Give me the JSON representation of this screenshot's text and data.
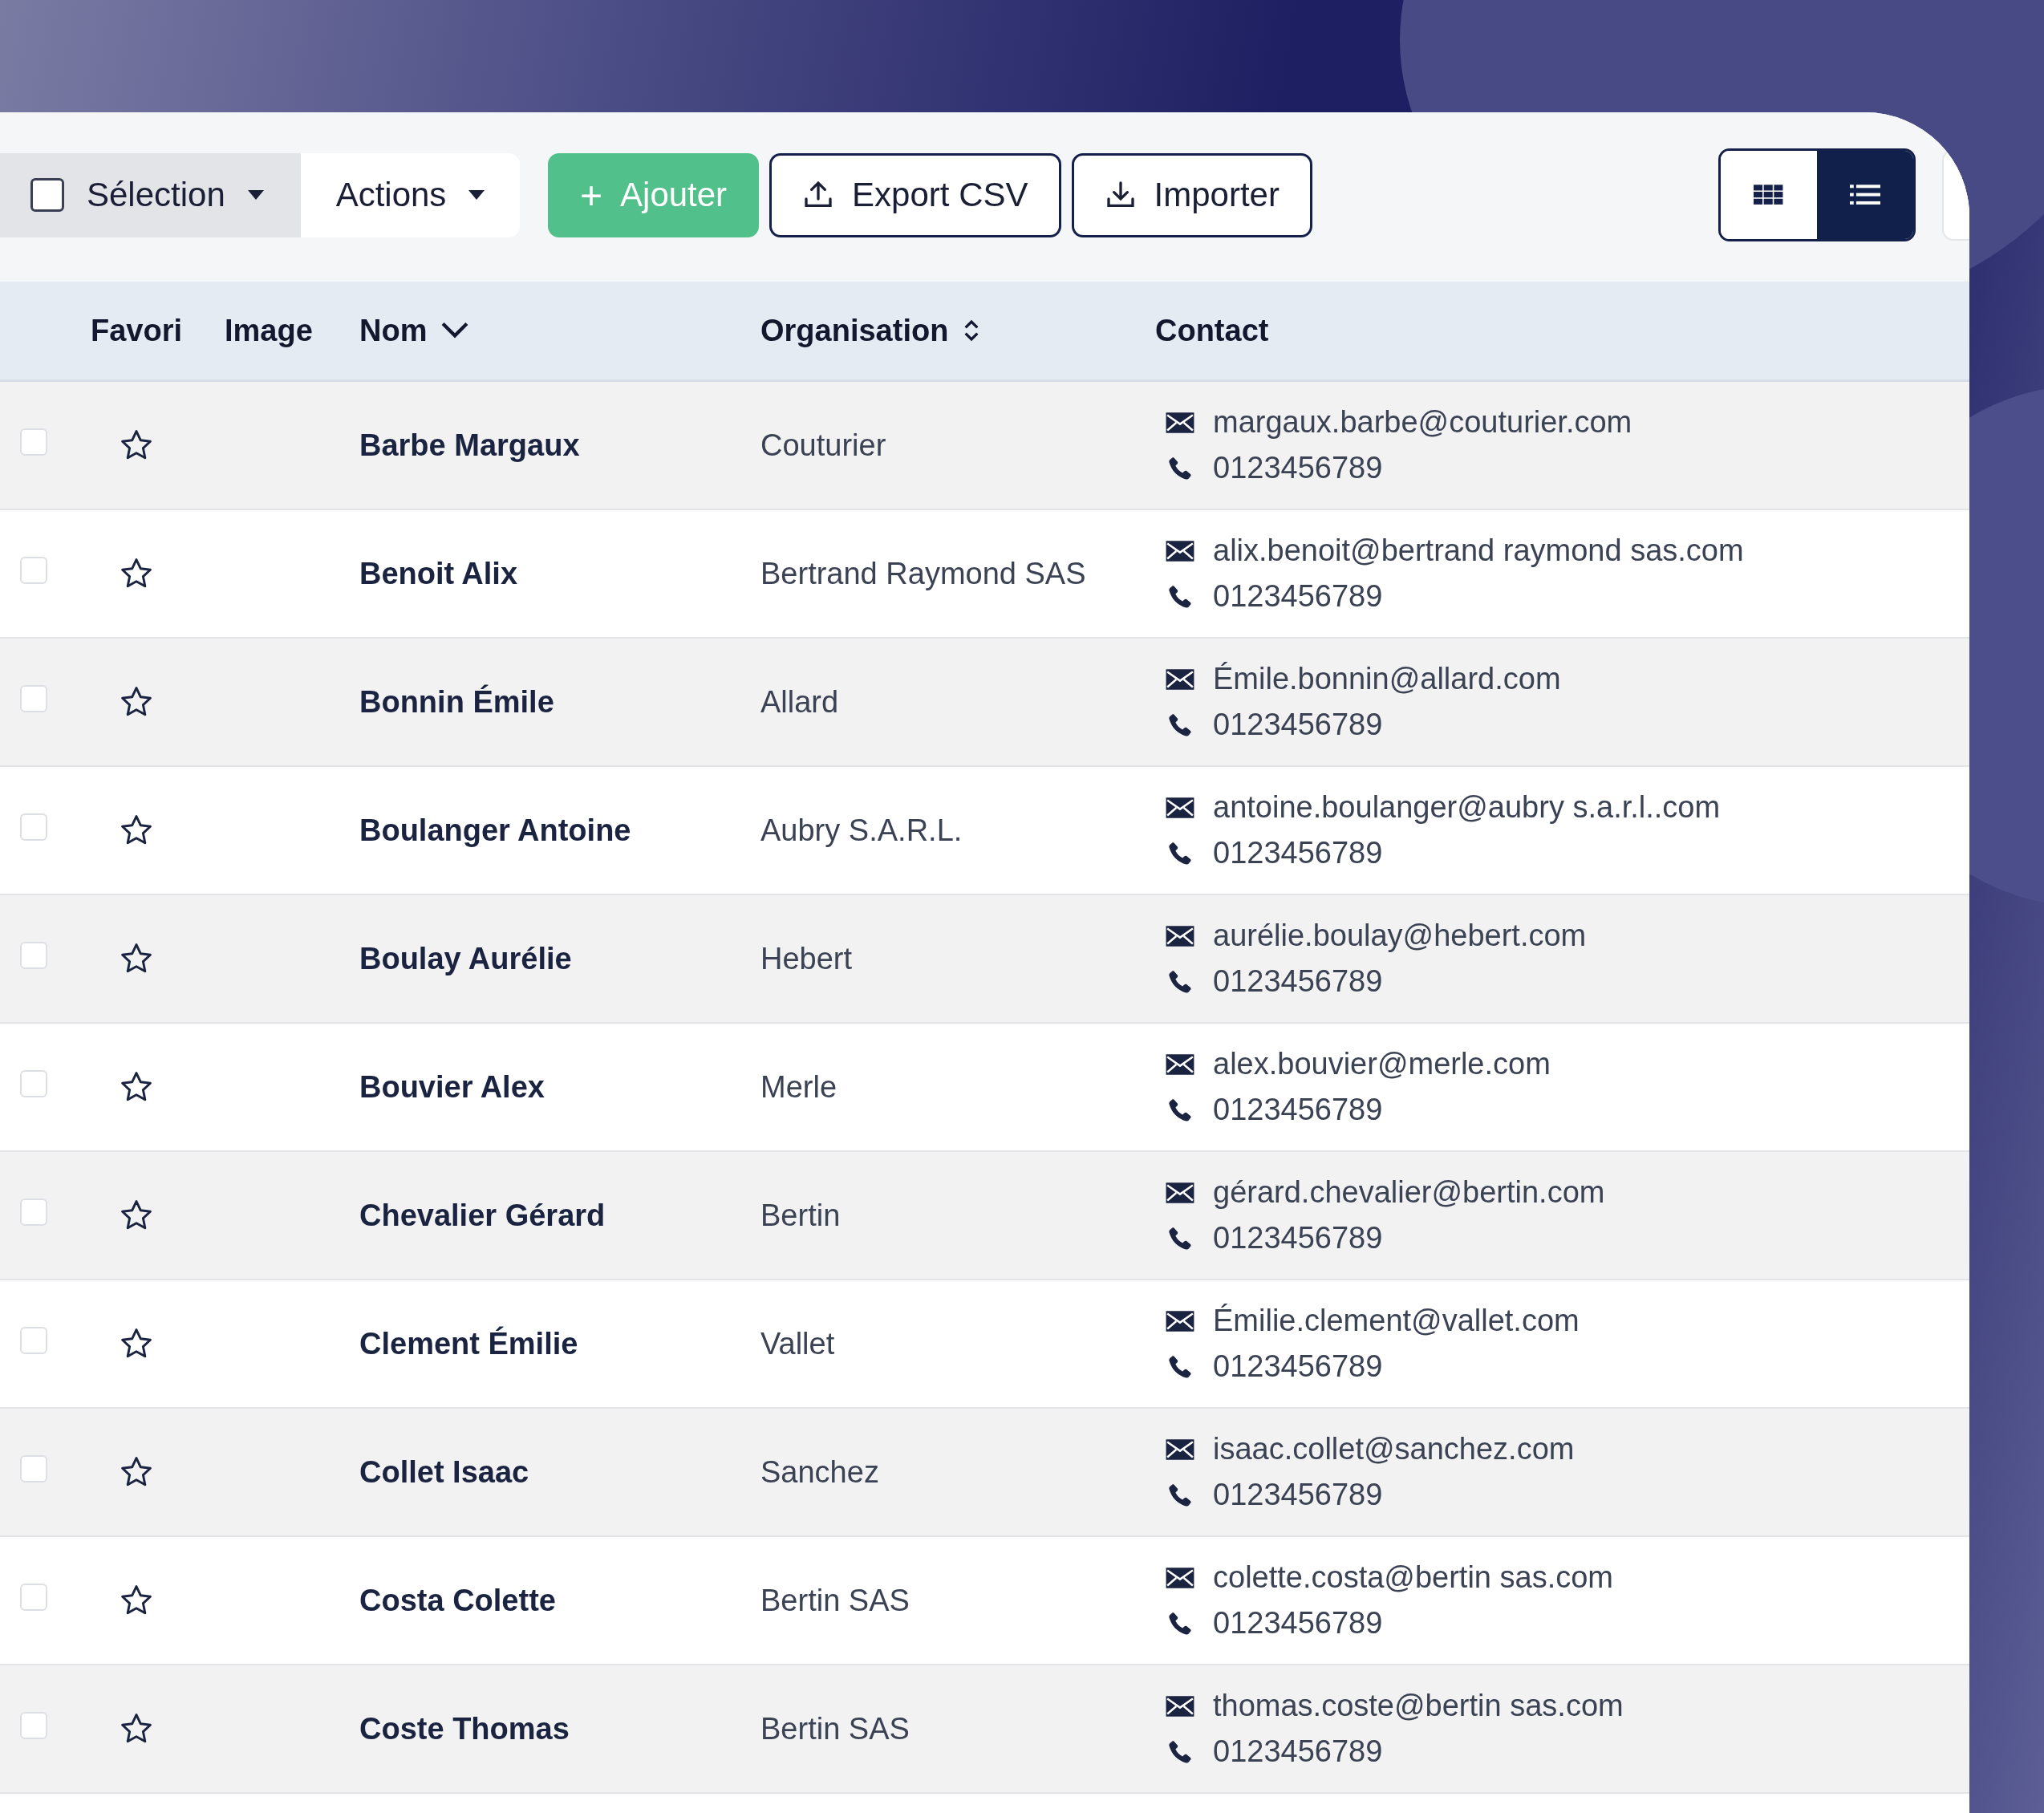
{
  "toolbar": {
    "selection": {
      "label": "Sélection",
      "checked": false
    },
    "actions": {
      "label": "Actions"
    },
    "buttons": [
      {
        "kind": "add",
        "label": "Ajouter",
        "icon": "+"
      },
      {
        "kind": "export",
        "label": "Export CSV"
      },
      {
        "kind": "import",
        "label": "Importer"
      }
    ],
    "view_toggle": [
      {
        "kind": "grid",
        "selected": false
      },
      {
        "kind": "list",
        "selected": true
      }
    ]
  },
  "table": {
    "columns": [
      {
        "label": "Favori"
      },
      {
        "label": "Image"
      },
      {
        "label": "Nom",
        "sorted": true
      },
      {
        "label": "Organisation",
        "sortable": true
      },
      {
        "label": "Contact"
      }
    ],
    "rows": [
      {
        "checked": false,
        "favorite": false,
        "name": "Barbe Margaux",
        "organisation": "Couturier",
        "email": "margaux.barbe@couturier.com",
        "phone": "0123456789"
      },
      {
        "checked": false,
        "favorite": false,
        "name": "Benoit Alix",
        "organisation": "Bertrand Raymond SAS",
        "email": "alix.benoit@bertrand raymond sas.com",
        "phone": "0123456789"
      },
      {
        "checked": false,
        "favorite": false,
        "name": "Bonnin Émile",
        "organisation": "Allard",
        "email": "Émile.bonnin@allard.com",
        "phone": "0123456789"
      },
      {
        "checked": false,
        "favorite": false,
        "name": "Boulanger Antoine",
        "organisation": "Aubry S.A.R.L.",
        "email": "antoine.boulanger@aubry s.a.r.l..com",
        "phone": "0123456789"
      },
      {
        "checked": false,
        "favorite": false,
        "name": "Boulay Aurélie",
        "organisation": "Hebert",
        "email": "aurélie.boulay@hebert.com",
        "phone": "0123456789"
      },
      {
        "checked": false,
        "favorite": false,
        "name": "Bouvier Alex",
        "organisation": "Merle",
        "email": "alex.bouvier@merle.com",
        "phone": "0123456789"
      },
      {
        "checked": false,
        "favorite": false,
        "name": "Chevalier Gérard",
        "organisation": "Bertin",
        "email": "gérard.chevalier@bertin.com",
        "phone": "0123456789"
      },
      {
        "checked": false,
        "favorite": false,
        "name": "Clement Émilie",
        "organisation": "Vallet",
        "email": "Émilie.clement@vallet.com",
        "phone": "0123456789"
      },
      {
        "checked": false,
        "favorite": false,
        "name": "Collet Isaac",
        "organisation": "Sanchez",
        "email": "isaac.collet@sanchez.com",
        "phone": "0123456789"
      },
      {
        "checked": false,
        "favorite": false,
        "name": "Costa Colette",
        "organisation": "Bertin SAS",
        "email": "colette.costa@bertin sas.com",
        "phone": "0123456789"
      },
      {
        "checked": false,
        "favorite": false,
        "name": "Coste Thomas",
        "organisation": "Bertin SAS",
        "email": "thomas.coste@bertin sas.com",
        "phone": "0123456789"
      }
    ]
  }
}
